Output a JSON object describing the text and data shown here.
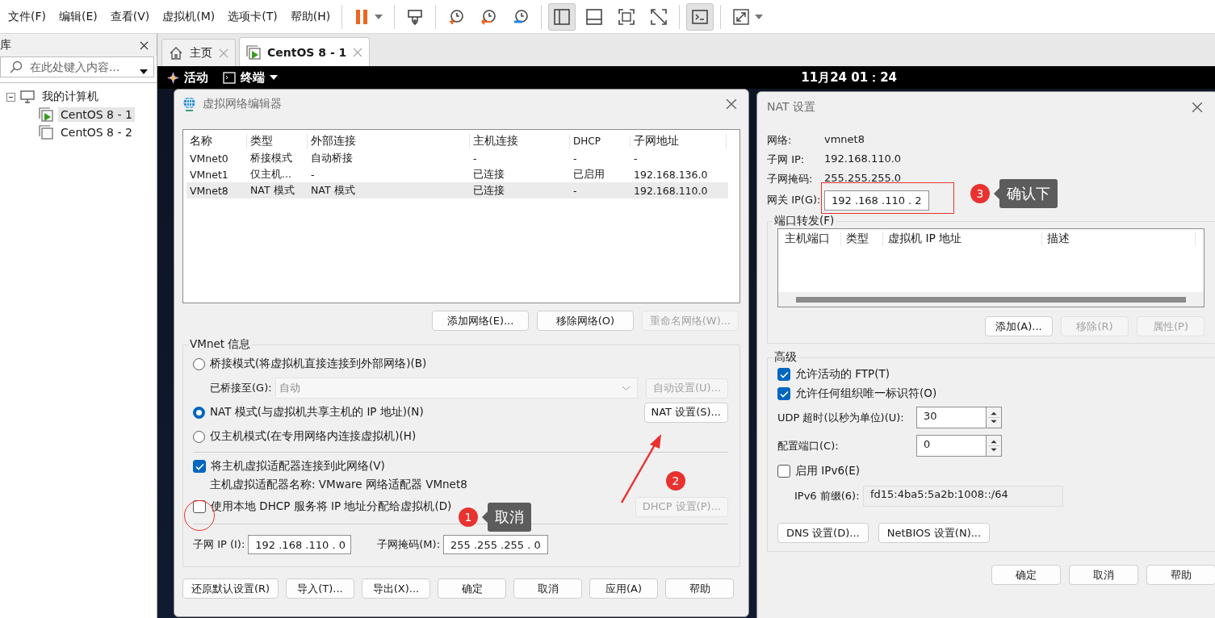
{
  "menu": [
    "文件(F)",
    "编辑(E)",
    "查看(V)",
    "虚拟机(M)",
    "选项卡(T)",
    "帮助(H)"
  ],
  "toolbar": [
    [
      {
        "kind": "pause",
        "pressed": false
      }
    ],
    [
      {
        "kind": "send-keys",
        "pressed": false
      }
    ],
    [
      {
        "kind": "snapshot",
        "pressed": false
      },
      {
        "kind": "revert",
        "pressed": false
      },
      {
        "kind": "manage",
        "pressed": false
      }
    ],
    [
      {
        "kind": "sidebar",
        "pressed": true
      },
      {
        "kind": "thumbnail",
        "pressed": false
      },
      {
        "kind": "fullscreen",
        "pressed": false
      },
      {
        "kind": "unity",
        "pressed": false
      }
    ],
    [
      {
        "kind": "console",
        "pressed": true
      }
    ],
    [
      {
        "kind": "stretch",
        "pressed": false
      }
    ]
  ],
  "sidebar": {
    "title": "库",
    "search": {
      "placeholder": "在此处键入内容..."
    },
    "tree": [
      {
        "label": "我的计算机",
        "kind": "computer",
        "expanded": true,
        "selected": false,
        "children": [
          {
            "label": "CentOS 8 - 1",
            "kind": "vm",
            "running": true,
            "selected": true
          },
          {
            "label": "CentOS 8 - 2",
            "kind": "vm",
            "running": false,
            "selected": false
          }
        ]
      }
    ]
  },
  "tabs": [
    {
      "label": "主页",
      "kind": "home",
      "selected": false
    },
    {
      "label": "CentOS 8 - 1",
      "kind": "vm",
      "selected": true
    }
  ],
  "guest_bar": {
    "activities": "活动",
    "terminal": "终端",
    "clock": "11月24 01：24"
  },
  "network_editor": {
    "title": "虚拟网络编辑器",
    "table": {
      "columns": [
        "名称",
        "类型",
        "外部连接",
        "主机连接",
        "DHCP",
        "子网地址"
      ],
      "rows": [
        {
          "cells": [
            "VMnet0",
            "桥接模式",
            "自动桥接",
            "-",
            "-",
            "-"
          ],
          "selected": false
        },
        {
          "cells": [
            "VMnet1",
            "仅主机...",
            "-",
            "已连接",
            "已启用",
            "192.168.136.0"
          ],
          "selected": false
        },
        {
          "cells": [
            "VMnet8",
            "NAT 模式",
            "NAT 模式",
            "已连接",
            "-",
            "192.168.110.0"
          ],
          "selected": true
        }
      ]
    },
    "table_buttons": [
      {
        "label": "添加网络(E)...",
        "disabled": false
      },
      {
        "label": "移除网络(O)",
        "disabled": false
      },
      {
        "label": "重命名网络(W)...",
        "disabled": true
      }
    ],
    "group_title": "VMnet 信息",
    "modes": [
      {
        "kind": "bridged",
        "label": "桥接模式(将虚拟机直接连接到外部网络)(B)",
        "selected": false
      },
      {
        "kind": "nat",
        "label": "NAT 模式(与虚拟机共享主机的 IP 地址)(N)",
        "selected": true,
        "button": "NAT 设置(S)..."
      },
      {
        "kind": "host-only",
        "label": "仅主机模式(在专用网络内连接虚拟机)(H)",
        "selected": false
      }
    ],
    "bridged_to": {
      "label": "已桥接至(G):",
      "value": "自动",
      "disabled": true,
      "button": "自动设置(U)..."
    },
    "connect_adapter": {
      "label": "将主机虚拟适配器连接到此网络(V)",
      "checked": true
    },
    "adapter_name": "主机虚拟适配器名称: VMware 网络适配器 VMnet8",
    "dhcp": {
      "label": "使用本地 DHCP 服务将 IP 地址分配给虚拟机(D)",
      "checked": false,
      "button": "DHCP 设置(P)...",
      "disabled": true
    },
    "subnet_ip": {
      "label": "子网 IP (I):",
      "value": "192 .168 .110 . 0"
    },
    "subnet_mask": {
      "label": "子网掩码(M):",
      "value": "255 .255 .255 . 0"
    },
    "footer": [
      "还原默认设置(R)",
      "导入(T)...",
      "导出(X)...",
      "确定",
      "取消",
      "应用(A)",
      "帮助"
    ]
  },
  "nat_settings": {
    "title": "NAT 设置",
    "info": [
      {
        "label": "网络:",
        "value": "vmnet8"
      },
      {
        "label": "子网 IP:",
        "value": "192.168.110.0"
      },
      {
        "label": "子网掩码:",
        "value": "255.255.255.0"
      }
    ],
    "gateway": {
      "label": "网关 IP(G):",
      "value": "192 .168 .110 . 2"
    },
    "port_forwarding": {
      "title": "端口转发(F)",
      "columns": [
        "主机端口",
        "类型",
        "虚拟机 IP 地址",
        "描述"
      ],
      "buttons": [
        {
          "label": "添加(A)...",
          "disabled": false
        },
        {
          "label": "移除(R)",
          "disabled": true
        },
        {
          "label": "属性(P)",
          "disabled": true
        }
      ]
    },
    "advanced": {
      "title": "高级",
      "checkboxes": [
        {
          "label": "允许活动的 FTP(T)",
          "checked": true
        },
        {
          "label": "允许任何组织唯一标识符(O)",
          "checked": true
        }
      ],
      "spinners": [
        {
          "label": "UDP 超时(以秒为单位)(U):",
          "value": "30"
        },
        {
          "label": "配置端口(C):",
          "value": "0"
        }
      ],
      "ipv6": {
        "label": "启用 IPv6(E)",
        "checked": false
      },
      "ipv6_prefix": {
        "label": "IPv6 前缀(6):",
        "value": "fd15:4ba5:5a2b:1008::/64",
        "disabled": true
      },
      "buttons": [
        "DNS 设置(D)...",
        "NetBIOS 设置(N)..."
      ]
    },
    "footer": [
      "确定",
      "取消",
      "帮助"
    ]
  },
  "annotations": [
    {
      "number": "1",
      "note": "取消"
    },
    {
      "number": "2"
    },
    {
      "number": "3",
      "note": "确认下"
    }
  ]
}
